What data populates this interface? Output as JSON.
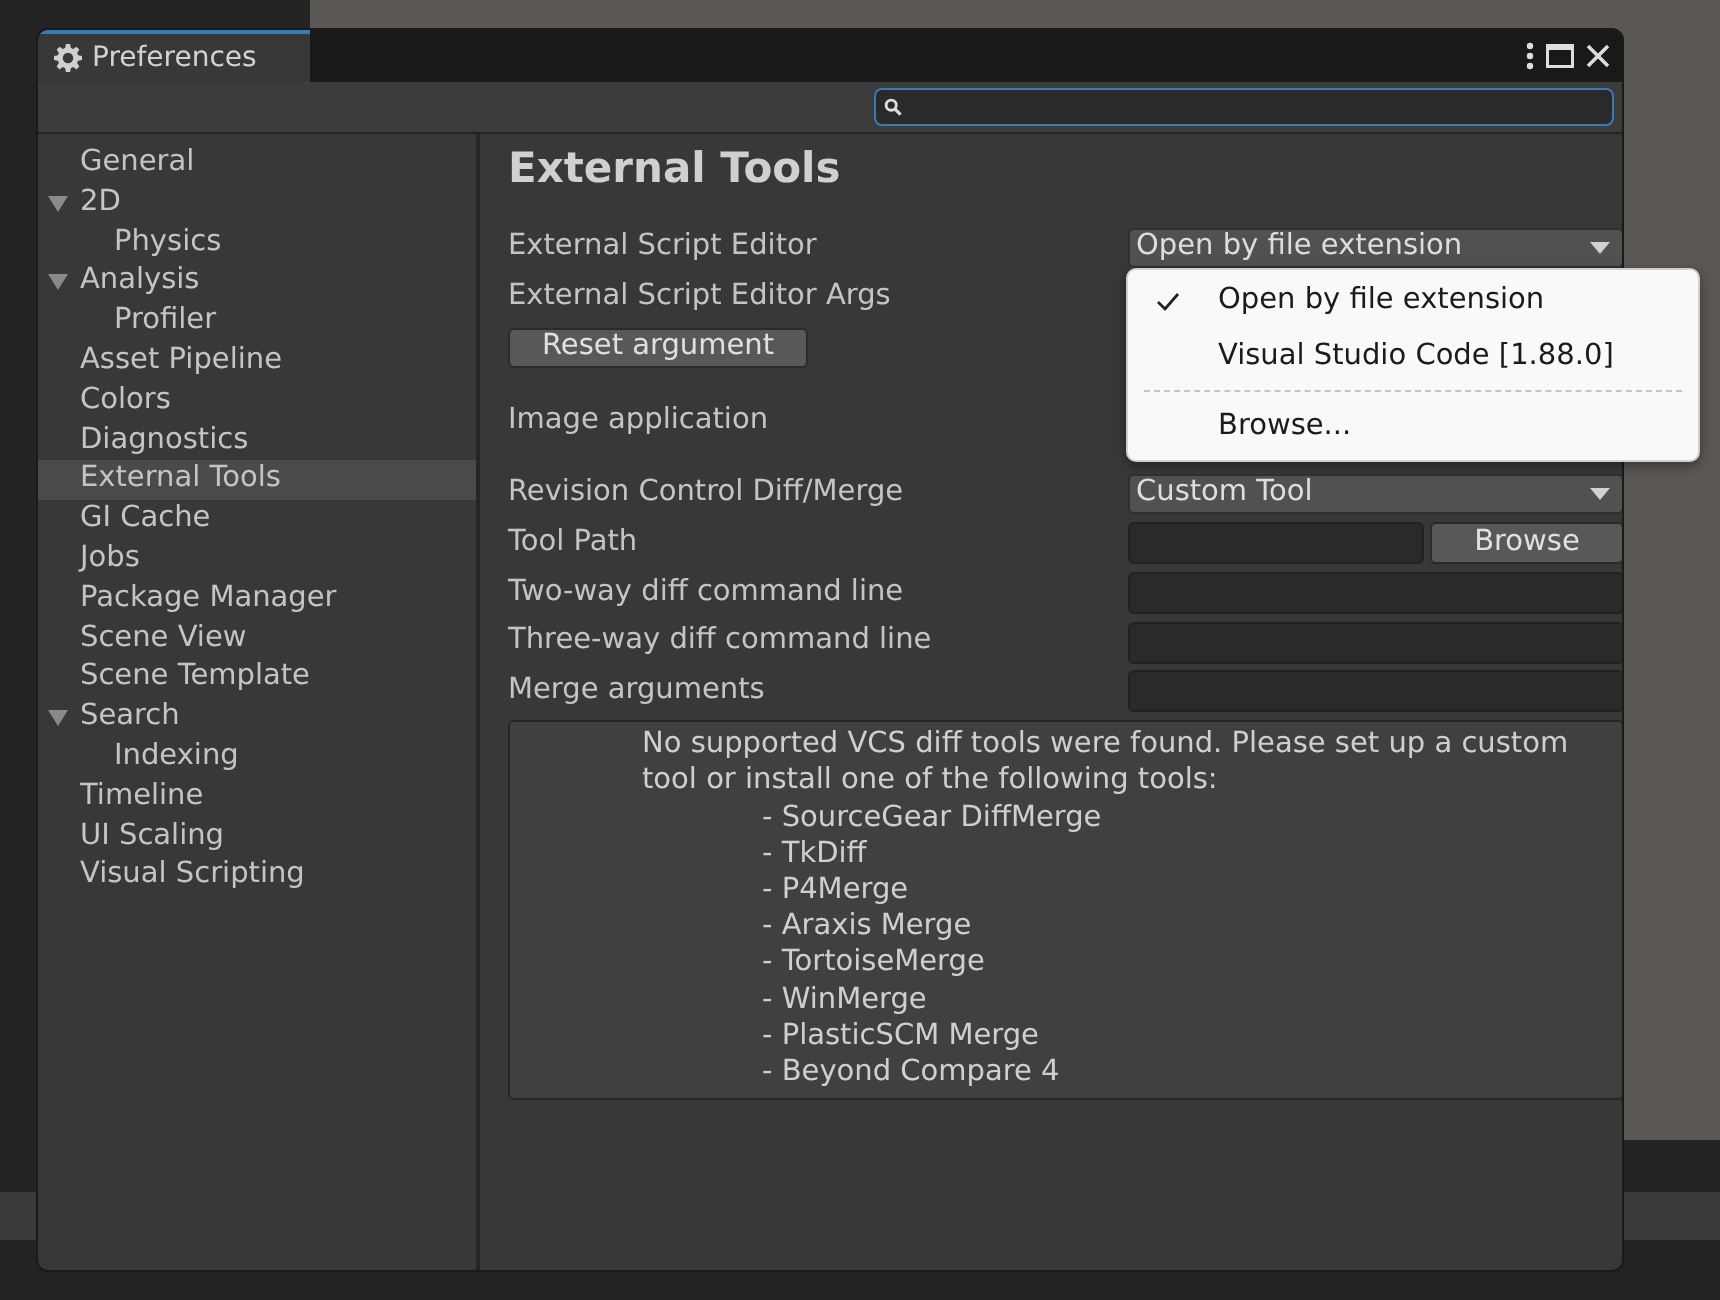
{
  "window": {
    "title": "Preferences"
  },
  "sidebar": {
    "items": [
      {
        "label": "General",
        "selected": false
      },
      {
        "label": "2D",
        "selected": false,
        "expanded": true,
        "children": [
          {
            "label": "Physics",
            "selected": false
          }
        ]
      },
      {
        "label": "Analysis",
        "selected": false,
        "expanded": true,
        "children": [
          {
            "label": "Profiler",
            "selected": false
          }
        ]
      },
      {
        "label": "Asset Pipeline",
        "selected": false
      },
      {
        "label": "Colors",
        "selected": false
      },
      {
        "label": "Diagnostics",
        "selected": false
      },
      {
        "label": "External Tools",
        "selected": true
      },
      {
        "label": "GI Cache",
        "selected": false
      },
      {
        "label": "Jobs",
        "selected": false
      },
      {
        "label": "Package Manager",
        "selected": false
      },
      {
        "label": "Scene View",
        "selected": false
      },
      {
        "label": "Scene Template",
        "selected": false
      },
      {
        "label": "Search",
        "selected": false,
        "expanded": true,
        "children": [
          {
            "label": "Indexing",
            "selected": false
          }
        ]
      },
      {
        "label": "Timeline",
        "selected": false
      },
      {
        "label": "UI Scaling",
        "selected": false
      },
      {
        "label": "Visual Scripting",
        "selected": false
      }
    ]
  },
  "heading": "External Tools",
  "rows": [
    {
      "kind": "dropdown",
      "label": "External Script Editor",
      "value": "Open by file extension"
    },
    {
      "kind": "label",
      "label": "External Script Editor Args"
    },
    {
      "kind": "button",
      "label": "Reset argument"
    },
    {
      "kind": "label",
      "label": "Image application"
    },
    {
      "kind": "dropdown",
      "label": "Revision Control Diff/Merge",
      "value": "Custom Tool"
    },
    {
      "kind": "path",
      "label": "Tool Path",
      "button": "Browse"
    },
    {
      "kind": "input",
      "label": "Two-way diff command line"
    },
    {
      "kind": "input",
      "label": "Three-way diff command line"
    },
    {
      "kind": "input",
      "label": "Merge arguments"
    }
  ],
  "message": {
    "text": "No supported VCS diff tools were found. Please set up a custom tool or install one of the following tools:",
    "items": [
      "- SourceGear DiffMerge",
      "- TkDiff",
      "- P4Merge",
      "- Araxis Merge",
      "- TortoiseMerge",
      "- WinMerge",
      "- PlasticSCM Merge",
      "- Beyond Compare 4"
    ]
  },
  "menu": {
    "items": [
      {
        "kind": "item",
        "label": "Open by file extension",
        "selected": true
      },
      {
        "kind": "item",
        "label": "Visual Studio Code [1.88.0]",
        "selected": false
      },
      {
        "kind": "separator"
      },
      {
        "kind": "item",
        "label": "Browse...",
        "selected": false
      }
    ]
  }
}
